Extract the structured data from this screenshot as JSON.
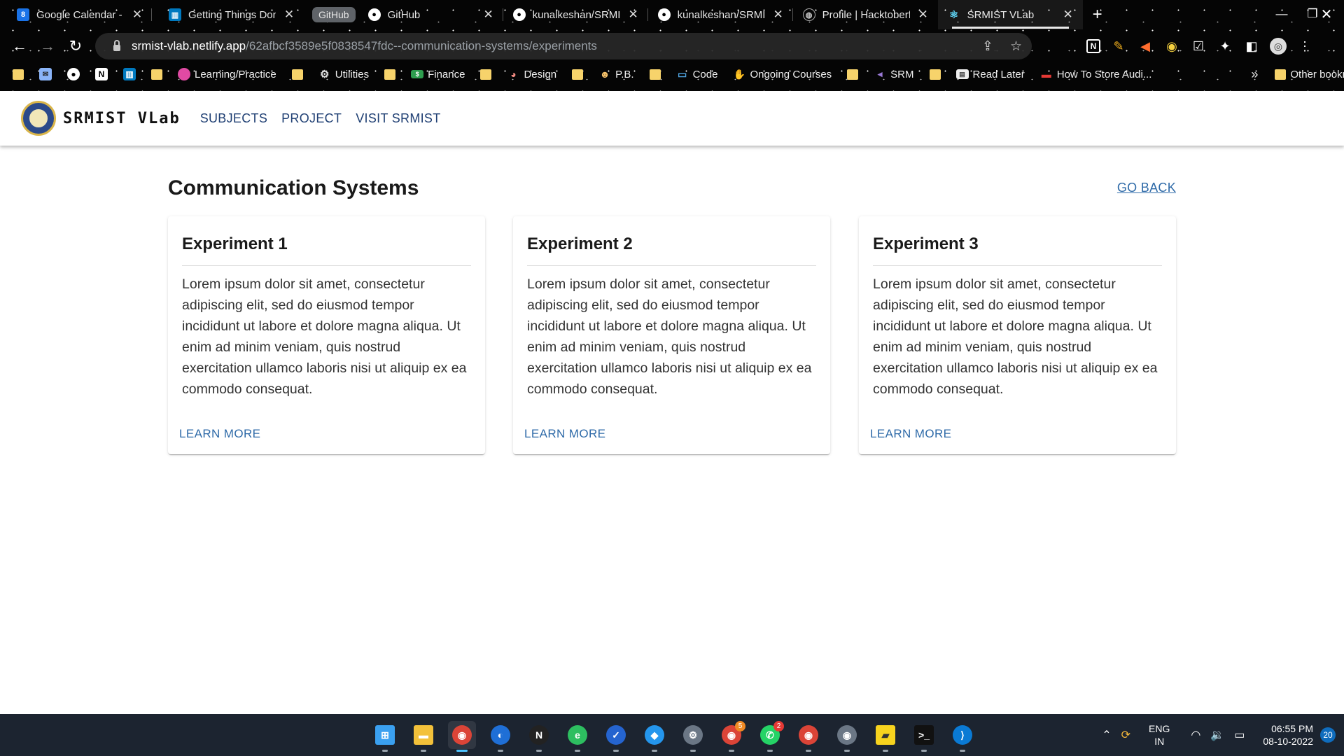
{
  "browser": {
    "tabs": [
      {
        "title": "Google Calendar - S",
        "icon": "calendar-icon",
        "color": "#1a73e8",
        "glyph": "8"
      },
      {
        "title": "Getting Things Done",
        "icon": "trello-icon",
        "color": "#0079bf",
        "glyph": "▥"
      },
      {
        "title": "GitHub",
        "icon": "github-icon",
        "color": "#000000",
        "glyph": "●"
      },
      {
        "title": "kunalkeshan/SRMIS",
        "icon": "github-icon",
        "color": "#000000",
        "glyph": "●"
      },
      {
        "title": "kunalkeshan/SRMIS",
        "icon": "github-icon",
        "color": "#000000",
        "glyph": "●"
      },
      {
        "title": "Profile | Hacktoberfe",
        "icon": "hacktoberfest-icon",
        "color": "#333333",
        "glyph": "◍"
      },
      {
        "title": "SRMIST VLab",
        "icon": "react-icon",
        "color": "#1c1c1c",
        "glyph": "⚛"
      }
    ],
    "tab_group_label": "GitHub",
    "address": {
      "host": "srmist-vlab.netlify.app",
      "path": "/62afbcf3589e5f0838547fdc--communication-systems/experiments"
    },
    "bookmarks": [
      {
        "label": "",
        "icon": "folder-icon"
      },
      {
        "label": "",
        "icon": "mail-icon"
      },
      {
        "label": "",
        "icon": "github-icon"
      },
      {
        "label": "",
        "icon": "notion-icon"
      },
      {
        "label": "",
        "icon": "trello-icon"
      },
      {
        "label": "",
        "icon": "folder-icon"
      },
      {
        "label": "Learning/Practice",
        "icon": "brain-icon"
      },
      {
        "label": "",
        "icon": "folder-icon"
      },
      {
        "label": "Utilities",
        "icon": "gear-icon"
      },
      {
        "label": "",
        "icon": "folder-icon"
      },
      {
        "label": "Finance",
        "icon": "money-icon"
      },
      {
        "label": "",
        "icon": "folder-icon"
      },
      {
        "label": "Design",
        "icon": "palette-icon"
      },
      {
        "label": "",
        "icon": "folder-icon"
      },
      {
        "label": "P.B.",
        "icon": "face-icon"
      },
      {
        "label": "",
        "icon": "folder-icon"
      },
      {
        "label": "Code",
        "icon": "laptop-icon"
      },
      {
        "label": "Ongoing Courses",
        "icon": "hand-icon"
      },
      {
        "label": "",
        "icon": "folder-icon"
      },
      {
        "label": "SRM",
        "icon": "srm-icon"
      },
      {
        "label": "",
        "icon": "folder-icon"
      },
      {
        "label": "Read Later",
        "icon": "book-icon"
      },
      {
        "label": "How To Store Audi...",
        "icon": "video-icon"
      }
    ],
    "bookmarks_overflow": "»",
    "other_bookmarks": "Other bookmarks"
  },
  "site": {
    "brand": "SRMIST VLab",
    "nav": [
      "SUBJECTS",
      "PROJECT",
      "VISIT SRMIST"
    ],
    "page_title": "Communication Systems",
    "go_back": "GO BACK",
    "experiments": [
      {
        "title": "Experiment 1",
        "body": "Lorem ipsum dolor sit amet, consectetur adipiscing elit, sed do eiusmod tempor incididunt ut labore et dolore magna aliqua. Ut enim ad minim veniam, quis nostrud exercitation ullamco laboris nisi ut aliquip ex ea commodo consequat.",
        "action": "LEARN MORE"
      },
      {
        "title": "Experiment 2",
        "body": "Lorem ipsum dolor sit amet, consectetur adipiscing elit, sed do eiusmod tempor incididunt ut labore et dolore magna aliqua. Ut enim ad minim veniam, quis nostrud exercitation ullamco laboris nisi ut aliquip ex ea commodo consequat.",
        "action": "LEARN MORE"
      },
      {
        "title": "Experiment 3",
        "body": "Lorem ipsum dolor sit amet, consectetur adipiscing elit, sed do eiusmod tempor incididunt ut labore et dolore magna aliqua. Ut enim ad minim veniam, quis nostrud exercitation ullamco laboris nisi ut aliquip ex ea commodo consequat.",
        "action": "LEARN MORE"
      }
    ]
  },
  "taskbar": {
    "apps": [
      {
        "name": "windows-start-icon",
        "color": "#3aa0f0",
        "glyph": "⊞",
        "badge": ""
      },
      {
        "name": "file-explorer-icon",
        "color": "#f3c13a",
        "glyph": "▬",
        "badge": ""
      },
      {
        "name": "chrome-icon",
        "color": "#db4437",
        "glyph": "◉",
        "badge": "",
        "active": true
      },
      {
        "name": "firefox-icon",
        "color": "#1f6fd6",
        "glyph": "◐",
        "badge": ""
      },
      {
        "name": "notion-icon",
        "color": "#222222",
        "glyph": "N",
        "badge": ""
      },
      {
        "name": "evernote-icon",
        "color": "#2dbe60",
        "glyph": "e",
        "badge": ""
      },
      {
        "name": "todo-icon",
        "color": "#2564cf",
        "glyph": "✓",
        "badge": ""
      },
      {
        "name": "docker-icon",
        "color": "#2496ed",
        "glyph": "◆",
        "badge": ""
      },
      {
        "name": "settings-icon",
        "color": "#6b7785",
        "glyph": "⚙",
        "badge": ""
      },
      {
        "name": "chrome-profile-icon",
        "color": "#db4437",
        "glyph": "◉",
        "badge": "5"
      },
      {
        "name": "whatsapp-icon",
        "color": "#25d366",
        "glyph": "✆",
        "badge": "2"
      },
      {
        "name": "chrome-dev-icon",
        "color": "#db4437",
        "glyph": "◉",
        "badge": ""
      },
      {
        "name": "chrome-canary-icon",
        "color": "#6b7785",
        "glyph": "◉",
        "badge": ""
      },
      {
        "name": "sticky-notes-icon",
        "color": "#f7d31e",
        "glyph": "▰",
        "badge": ""
      },
      {
        "name": "terminal-icon",
        "color": "#111111",
        "glyph": ">_",
        "badge": ""
      },
      {
        "name": "vscode-icon",
        "color": "#0a7ad4",
        "glyph": "⟩",
        "badge": ""
      }
    ],
    "lang": [
      "ENG",
      "IN"
    ],
    "time": "06:55 PM",
    "date": "08-10-2022",
    "notifications": "20"
  }
}
